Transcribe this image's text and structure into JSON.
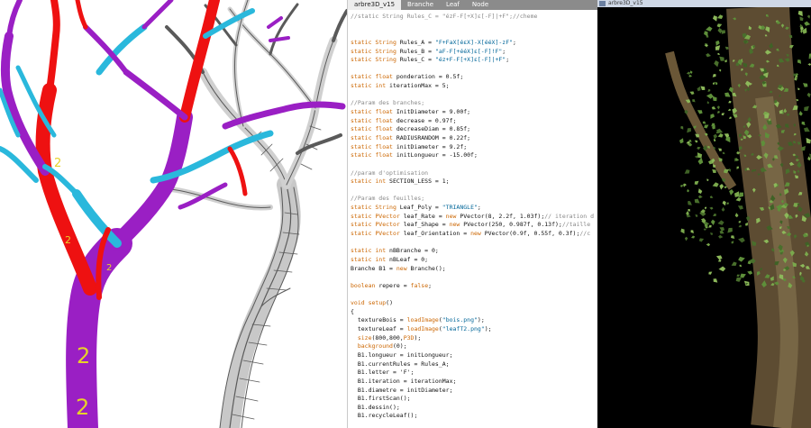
{
  "editor": {
    "tabs": [
      {
        "label": "arbre3D_v15",
        "active": true
      },
      {
        "label": "Branche",
        "active": false
      },
      {
        "label": "Leaf",
        "active": false
      },
      {
        "label": "Node",
        "active": false
      }
    ],
    "code_lines": [
      {
        "parts": [
          {
            "t": "//static String Rules_C = \"ézF-F[+X]ε[-F]|+F\";//cheme",
            "c": "cm"
          }
        ]
      },
      {
        "parts": []
      },
      {
        "parts": []
      },
      {
        "parts": [
          {
            "t": "static String ",
            "c": "kw"
          },
          {
            "t": "Rules_A = ",
            "c": ""
          },
          {
            "t": "\"F+FaX[éεX]-X[ééX]-zF\"",
            "c": "st"
          },
          {
            "t": ";",
            "c": ""
          }
        ]
      },
      {
        "parts": [
          {
            "t": "static String ",
            "c": "kw"
          },
          {
            "t": "Rules_B = ",
            "c": ""
          },
          {
            "t": "\"aF-F[+ééX]ε[-F]!F\"",
            "c": "st"
          },
          {
            "t": ";",
            "c": ""
          }
        ]
      },
      {
        "parts": [
          {
            "t": "static String ",
            "c": "kw"
          },
          {
            "t": "Rules_C = ",
            "c": ""
          },
          {
            "t": "\"éz+F-F[+X]ε[-F]|+F\"",
            "c": "st"
          },
          {
            "t": ";",
            "c": ""
          }
        ]
      },
      {
        "parts": []
      },
      {
        "parts": [
          {
            "t": "static float ",
            "c": "kw"
          },
          {
            "t": "ponderation = 0.5f;",
            "c": ""
          }
        ]
      },
      {
        "parts": [
          {
            "t": "static int ",
            "c": "kw"
          },
          {
            "t": "iterationMax = 5;",
            "c": ""
          }
        ]
      },
      {
        "parts": []
      },
      {
        "parts": [
          {
            "t": "//Param des branches;",
            "c": "cm"
          }
        ]
      },
      {
        "parts": [
          {
            "t": "static float ",
            "c": "kw"
          },
          {
            "t": "InitDiameter = 9.00f;",
            "c": ""
          }
        ]
      },
      {
        "parts": [
          {
            "t": "static float ",
            "c": "kw"
          },
          {
            "t": "decrease = 0.97f;",
            "c": ""
          }
        ]
      },
      {
        "parts": [
          {
            "t": "static float ",
            "c": "kw"
          },
          {
            "t": "decreaseDiam = 0.85f;",
            "c": ""
          }
        ]
      },
      {
        "parts": [
          {
            "t": "static float ",
            "c": "kw"
          },
          {
            "t": "RADIUSRANDOM = 0.22f;",
            "c": ""
          }
        ]
      },
      {
        "parts": [
          {
            "t": "static float ",
            "c": "kw"
          },
          {
            "t": "initDiameter = 9.2f;",
            "c": ""
          }
        ]
      },
      {
        "parts": [
          {
            "t": "static float ",
            "c": "kw"
          },
          {
            "t": "initLongueur = -15.00f;",
            "c": ""
          }
        ]
      },
      {
        "parts": []
      },
      {
        "parts": [
          {
            "t": "//param d'optimisation",
            "c": "cm"
          }
        ]
      },
      {
        "parts": [
          {
            "t": "static int ",
            "c": "kw"
          },
          {
            "t": "SECTION_LESS = 1;",
            "c": ""
          }
        ]
      },
      {
        "parts": []
      },
      {
        "parts": [
          {
            "t": "//Param des feuilles;",
            "c": "cm"
          }
        ]
      },
      {
        "parts": [
          {
            "t": "static String ",
            "c": "kw"
          },
          {
            "t": "Leaf_Poly = ",
            "c": ""
          },
          {
            "t": "\"TRIANGLE\"",
            "c": "st"
          },
          {
            "t": ";",
            "c": ""
          }
        ]
      },
      {
        "parts": [
          {
            "t": "static PVector ",
            "c": "kw"
          },
          {
            "t": "leaf_Rate = ",
            "c": ""
          },
          {
            "t": "new ",
            "c": "kw"
          },
          {
            "t": "PVector(8, 2.2f, 1.03f);",
            "c": ""
          },
          {
            "t": "// iteration d",
            "c": "cm"
          }
        ]
      },
      {
        "parts": [
          {
            "t": "static PVector ",
            "c": "kw"
          },
          {
            "t": "leaf_Shape = ",
            "c": ""
          },
          {
            "t": "new ",
            "c": "kw"
          },
          {
            "t": "PVector(250, 0.987f, 0.13f);",
            "c": ""
          },
          {
            "t": "//taille",
            "c": "cm"
          }
        ]
      },
      {
        "parts": [
          {
            "t": "static PVector ",
            "c": "kw"
          },
          {
            "t": "leaf_Orientation = ",
            "c": ""
          },
          {
            "t": "new ",
            "c": "kw"
          },
          {
            "t": "PVector(0.9f, 0.55f, 0.3f);",
            "c": ""
          },
          {
            "t": "//c",
            "c": "cm"
          }
        ]
      },
      {
        "parts": []
      },
      {
        "parts": [
          {
            "t": "static int ",
            "c": "kw"
          },
          {
            "t": "nBBranche = 0;",
            "c": ""
          }
        ]
      },
      {
        "parts": [
          {
            "t": "static int ",
            "c": "kw"
          },
          {
            "t": "nBLeaf = 0;",
            "c": ""
          }
        ]
      },
      {
        "parts": [
          {
            "t": "Branche B1 = ",
            "c": ""
          },
          {
            "t": "new ",
            "c": "kw"
          },
          {
            "t": "Branche();",
            "c": ""
          }
        ]
      },
      {
        "parts": []
      },
      {
        "parts": [
          {
            "t": "boolean ",
            "c": "kw"
          },
          {
            "t": "repere = ",
            "c": ""
          },
          {
            "t": "false",
            "c": "kw"
          },
          {
            "t": ";",
            "c": ""
          }
        ]
      },
      {
        "parts": []
      },
      {
        "parts": [
          {
            "t": "void ",
            "c": "kw"
          },
          {
            "t": "setup",
            "c": "fn"
          },
          {
            "t": "()",
            "c": ""
          }
        ]
      },
      {
        "parts": [
          {
            "t": "{",
            "c": ""
          }
        ]
      },
      {
        "parts": [
          {
            "t": "  textureBois = ",
            "c": ""
          },
          {
            "t": "loadImage",
            "c": "fn"
          },
          {
            "t": "(",
            "c": ""
          },
          {
            "t": "\"bois.png\"",
            "c": "st"
          },
          {
            "t": ");",
            "c": ""
          }
        ]
      },
      {
        "parts": [
          {
            "t": "  textureLeaf = ",
            "c": ""
          },
          {
            "t": "loadImage",
            "c": "fn"
          },
          {
            "t": "(",
            "c": ""
          },
          {
            "t": "\"leafT2.png\"",
            "c": "st"
          },
          {
            "t": ");",
            "c": ""
          }
        ]
      },
      {
        "parts": [
          {
            "t": "  ",
            "c": ""
          },
          {
            "t": "size",
            "c": "fn"
          },
          {
            "t": "(800,800,",
            "c": ""
          },
          {
            "t": "P3D",
            "c": "kw"
          },
          {
            "t": ");",
            "c": ""
          }
        ]
      },
      {
        "parts": [
          {
            "t": "  ",
            "c": ""
          },
          {
            "t": "background",
            "c": "fn"
          },
          {
            "t": "(0);",
            "c": ""
          }
        ]
      },
      {
        "parts": [
          {
            "t": "  B1.longueur = initLongueur;",
            "c": ""
          }
        ]
      },
      {
        "parts": [
          {
            "t": "  B1.currentRules = Rules_A;",
            "c": ""
          }
        ]
      },
      {
        "parts": [
          {
            "t": "  B1.letter = 'F';",
            "c": ""
          }
        ]
      },
      {
        "parts": [
          {
            "t": "  B1.iteration = iterationMax;",
            "c": ""
          }
        ]
      },
      {
        "parts": [
          {
            "t": "  B1.diametre = initDiameter;",
            "c": ""
          }
        ]
      },
      {
        "parts": [
          {
            "t": "  B1.firstScan();",
            "c": ""
          }
        ]
      },
      {
        "parts": [
          {
            "t": "  B1.dessin();",
            "c": ""
          }
        ]
      },
      {
        "parts": [
          {
            "t": "  B1.recycleLeaf();",
            "c": ""
          }
        ]
      }
    ]
  },
  "sketch_window": {
    "title": "arbre3D_v15"
  },
  "viewport_left": {
    "labels": [
      {
        "text": "2",
        "name": "node-label"
      },
      {
        "text": "2",
        "name": "node-label"
      },
      {
        "text": "2",
        "name": "node-label"
      },
      {
        "text": "2",
        "name": "node-label"
      },
      {
        "text": "2",
        "name": "node-label"
      }
    ]
  },
  "colors": {
    "branch_purple": "#9a1fc4",
    "branch_red": "#ee1111",
    "branch_cyan": "#2ab8dc",
    "wire": "#555555",
    "leaf_green": "#5e8f3a",
    "bark": "#6b5a3a",
    "label": "#e6d22a"
  }
}
